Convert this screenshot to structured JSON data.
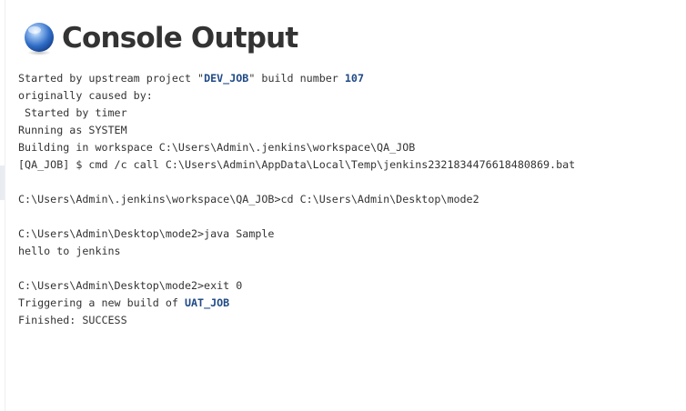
{
  "header": {
    "title": "Console Output",
    "icon": "terminal-orb-icon"
  },
  "colors": {
    "link": "#204a87",
    "text": "#333333",
    "icon_blue": "#2f6cc5"
  },
  "console": {
    "started_prefix": "Started by upstream project \"",
    "upstream_project": "DEV_JOB",
    "started_middle": "\" build number ",
    "build_number": "107",
    "caused_by": "originally caused by:",
    "started_by_timer": " Started by timer",
    "running_as": "Running as SYSTEM",
    "building_in": "Building in workspace C:\\Users\\Admin\\.jenkins\\workspace\\QA_JOB",
    "cmd_call": "[QA_JOB] $ cmd /c call C:\\Users\\Admin\\AppData\\Local\\Temp\\jenkins2321834476618480869.bat",
    "cd_line": "C:\\Users\\Admin\\.jenkins\\workspace\\QA_JOB>cd C:\\Users\\Admin\\Desktop\\mode2",
    "java_line": "C:\\Users\\Admin\\Desktop\\mode2>java Sample",
    "hello_line": "hello to jenkins",
    "exit_line": "C:\\Users\\Admin\\Desktop\\mode2>exit 0",
    "triggering_prefix": "Triggering a new build of ",
    "downstream_project": "UAT_JOB",
    "finished": "Finished: SUCCESS"
  }
}
